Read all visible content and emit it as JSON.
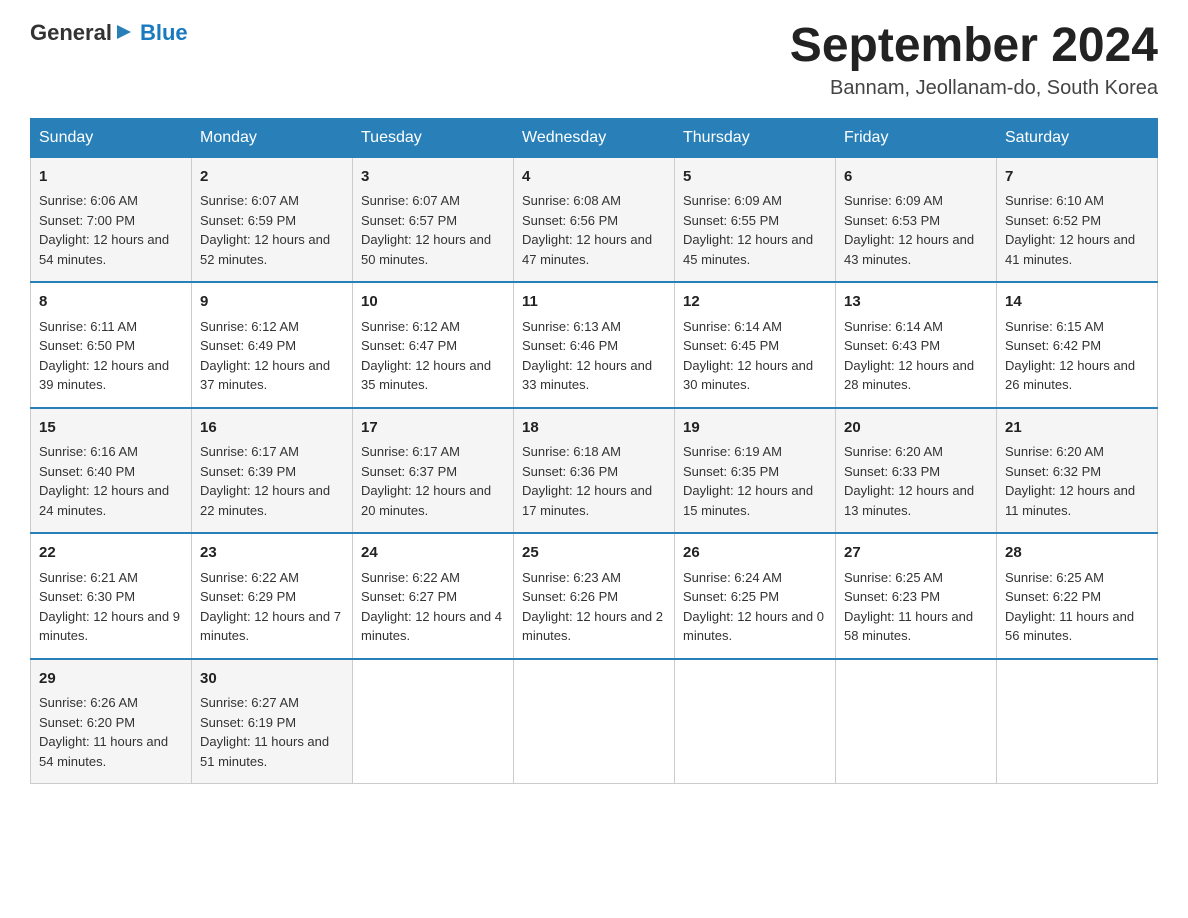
{
  "header": {
    "logo": {
      "general": "General",
      "arrow_icon": "▶",
      "blue": "Blue"
    },
    "title": "September 2024",
    "location": "Bannam, Jeollanam-do, South Korea"
  },
  "days_of_week": [
    "Sunday",
    "Monday",
    "Tuesday",
    "Wednesday",
    "Thursday",
    "Friday",
    "Saturday"
  ],
  "weeks": [
    {
      "days": [
        {
          "num": "1",
          "sunrise": "6:06 AM",
          "sunset": "7:00 PM",
          "daylight": "12 hours and 54 minutes."
        },
        {
          "num": "2",
          "sunrise": "6:07 AM",
          "sunset": "6:59 PM",
          "daylight": "12 hours and 52 minutes."
        },
        {
          "num": "3",
          "sunrise": "6:07 AM",
          "sunset": "6:57 PM",
          "daylight": "12 hours and 50 minutes."
        },
        {
          "num": "4",
          "sunrise": "6:08 AM",
          "sunset": "6:56 PM",
          "daylight": "12 hours and 47 minutes."
        },
        {
          "num": "5",
          "sunrise": "6:09 AM",
          "sunset": "6:55 PM",
          "daylight": "12 hours and 45 minutes."
        },
        {
          "num": "6",
          "sunrise": "6:09 AM",
          "sunset": "6:53 PM",
          "daylight": "12 hours and 43 minutes."
        },
        {
          "num": "7",
          "sunrise": "6:10 AM",
          "sunset": "6:52 PM",
          "daylight": "12 hours and 41 minutes."
        }
      ]
    },
    {
      "days": [
        {
          "num": "8",
          "sunrise": "6:11 AM",
          "sunset": "6:50 PM",
          "daylight": "12 hours and 39 minutes."
        },
        {
          "num": "9",
          "sunrise": "6:12 AM",
          "sunset": "6:49 PM",
          "daylight": "12 hours and 37 minutes."
        },
        {
          "num": "10",
          "sunrise": "6:12 AM",
          "sunset": "6:47 PM",
          "daylight": "12 hours and 35 minutes."
        },
        {
          "num": "11",
          "sunrise": "6:13 AM",
          "sunset": "6:46 PM",
          "daylight": "12 hours and 33 minutes."
        },
        {
          "num": "12",
          "sunrise": "6:14 AM",
          "sunset": "6:45 PM",
          "daylight": "12 hours and 30 minutes."
        },
        {
          "num": "13",
          "sunrise": "6:14 AM",
          "sunset": "6:43 PM",
          "daylight": "12 hours and 28 minutes."
        },
        {
          "num": "14",
          "sunrise": "6:15 AM",
          "sunset": "6:42 PM",
          "daylight": "12 hours and 26 minutes."
        }
      ]
    },
    {
      "days": [
        {
          "num": "15",
          "sunrise": "6:16 AM",
          "sunset": "6:40 PM",
          "daylight": "12 hours and 24 minutes."
        },
        {
          "num": "16",
          "sunrise": "6:17 AM",
          "sunset": "6:39 PM",
          "daylight": "12 hours and 22 minutes."
        },
        {
          "num": "17",
          "sunrise": "6:17 AM",
          "sunset": "6:37 PM",
          "daylight": "12 hours and 20 minutes."
        },
        {
          "num": "18",
          "sunrise": "6:18 AM",
          "sunset": "6:36 PM",
          "daylight": "12 hours and 17 minutes."
        },
        {
          "num": "19",
          "sunrise": "6:19 AM",
          "sunset": "6:35 PM",
          "daylight": "12 hours and 15 minutes."
        },
        {
          "num": "20",
          "sunrise": "6:20 AM",
          "sunset": "6:33 PM",
          "daylight": "12 hours and 13 minutes."
        },
        {
          "num": "21",
          "sunrise": "6:20 AM",
          "sunset": "6:32 PM",
          "daylight": "12 hours and 11 minutes."
        }
      ]
    },
    {
      "days": [
        {
          "num": "22",
          "sunrise": "6:21 AM",
          "sunset": "6:30 PM",
          "daylight": "12 hours and 9 minutes."
        },
        {
          "num": "23",
          "sunrise": "6:22 AM",
          "sunset": "6:29 PM",
          "daylight": "12 hours and 7 minutes."
        },
        {
          "num": "24",
          "sunrise": "6:22 AM",
          "sunset": "6:27 PM",
          "daylight": "12 hours and 4 minutes."
        },
        {
          "num": "25",
          "sunrise": "6:23 AM",
          "sunset": "6:26 PM",
          "daylight": "12 hours and 2 minutes."
        },
        {
          "num": "26",
          "sunrise": "6:24 AM",
          "sunset": "6:25 PM",
          "daylight": "12 hours and 0 minutes."
        },
        {
          "num": "27",
          "sunrise": "6:25 AM",
          "sunset": "6:23 PM",
          "daylight": "11 hours and 58 minutes."
        },
        {
          "num": "28",
          "sunrise": "6:25 AM",
          "sunset": "6:22 PM",
          "daylight": "11 hours and 56 minutes."
        }
      ]
    },
    {
      "days": [
        {
          "num": "29",
          "sunrise": "6:26 AM",
          "sunset": "6:20 PM",
          "daylight": "11 hours and 54 minutes."
        },
        {
          "num": "30",
          "sunrise": "6:27 AM",
          "sunset": "6:19 PM",
          "daylight": "11 hours and 51 minutes."
        },
        null,
        null,
        null,
        null,
        null
      ]
    }
  ]
}
